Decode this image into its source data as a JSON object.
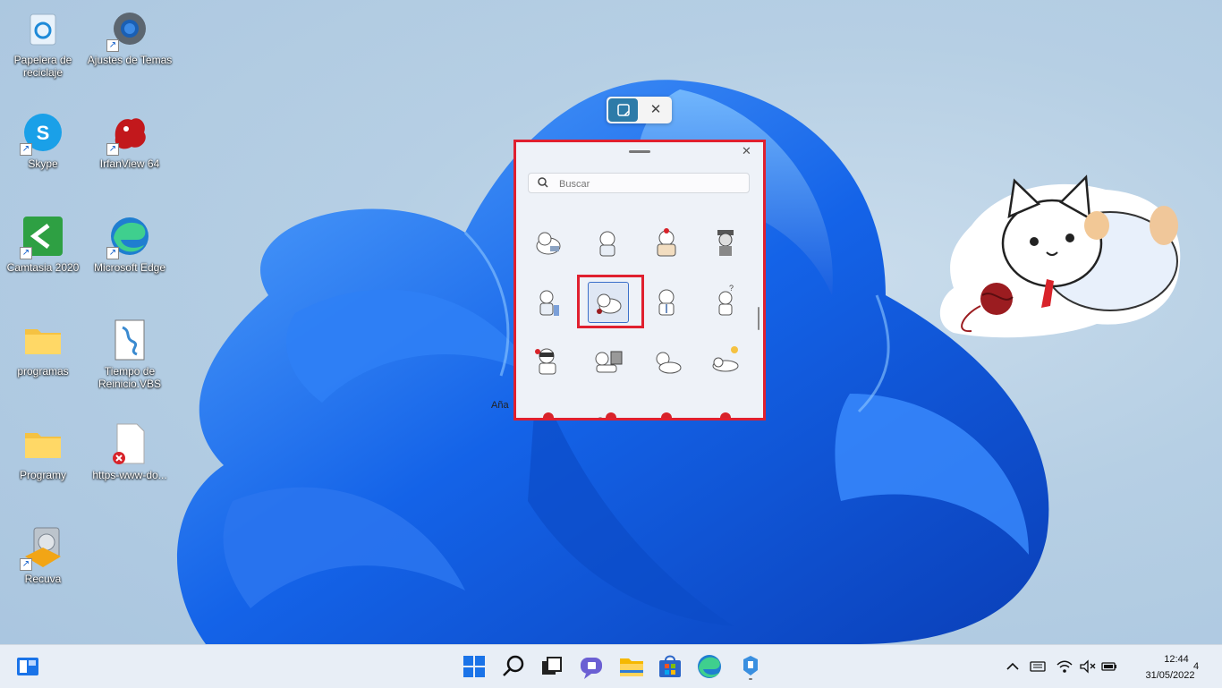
{
  "desktop": {
    "icons": [
      {
        "label": "Papelera de\nreciclaje",
        "icon": "recycle-bin-icon"
      },
      {
        "label": "Ajustes de Temas",
        "icon": "gear-icon"
      },
      {
        "label": "Skype",
        "icon": "skype-icon"
      },
      {
        "label": "IrfanView 64",
        "icon": "irfanview-icon"
      },
      {
        "label": "Camtasia 2020",
        "icon": "camtasia-icon"
      },
      {
        "label": "Microsoft Edge",
        "icon": "edge-icon"
      },
      {
        "label": "programas",
        "icon": "folder-icon"
      },
      {
        "label": "Tiempo  de\nReinicio.VBS",
        "icon": "vbs-script-icon"
      },
      {
        "label": "Programy",
        "icon": "folder-icon"
      },
      {
        "label": "https-www-do...",
        "icon": "broken-file-icon"
      },
      {
        "label": "Recuva",
        "icon": "recuva-icon"
      }
    ]
  },
  "sticker_toolbar": {
    "sticker_icon": "sticker-edit-icon",
    "close_glyph": "✕"
  },
  "picker": {
    "close_glyph": "✕",
    "search_placeholder": "Buscar",
    "stray_text": "Aña"
  },
  "taskbar": {
    "widgets_icon": "widgets-icon",
    "apps": [
      "start-icon",
      "search-icon",
      "task-view-icon",
      "chat-icon",
      "file-explorer-icon",
      "store-icon",
      "edge-icon",
      "sticker-app-icon"
    ],
    "tray": {
      "chevron": "^",
      "time": "12:44",
      "date": "31/05/2022",
      "notifications": "4"
    }
  },
  "colors": {
    "accent": "#2d7ba8",
    "highlight": "#e0202f",
    "bloom": "#1a6cf0"
  }
}
